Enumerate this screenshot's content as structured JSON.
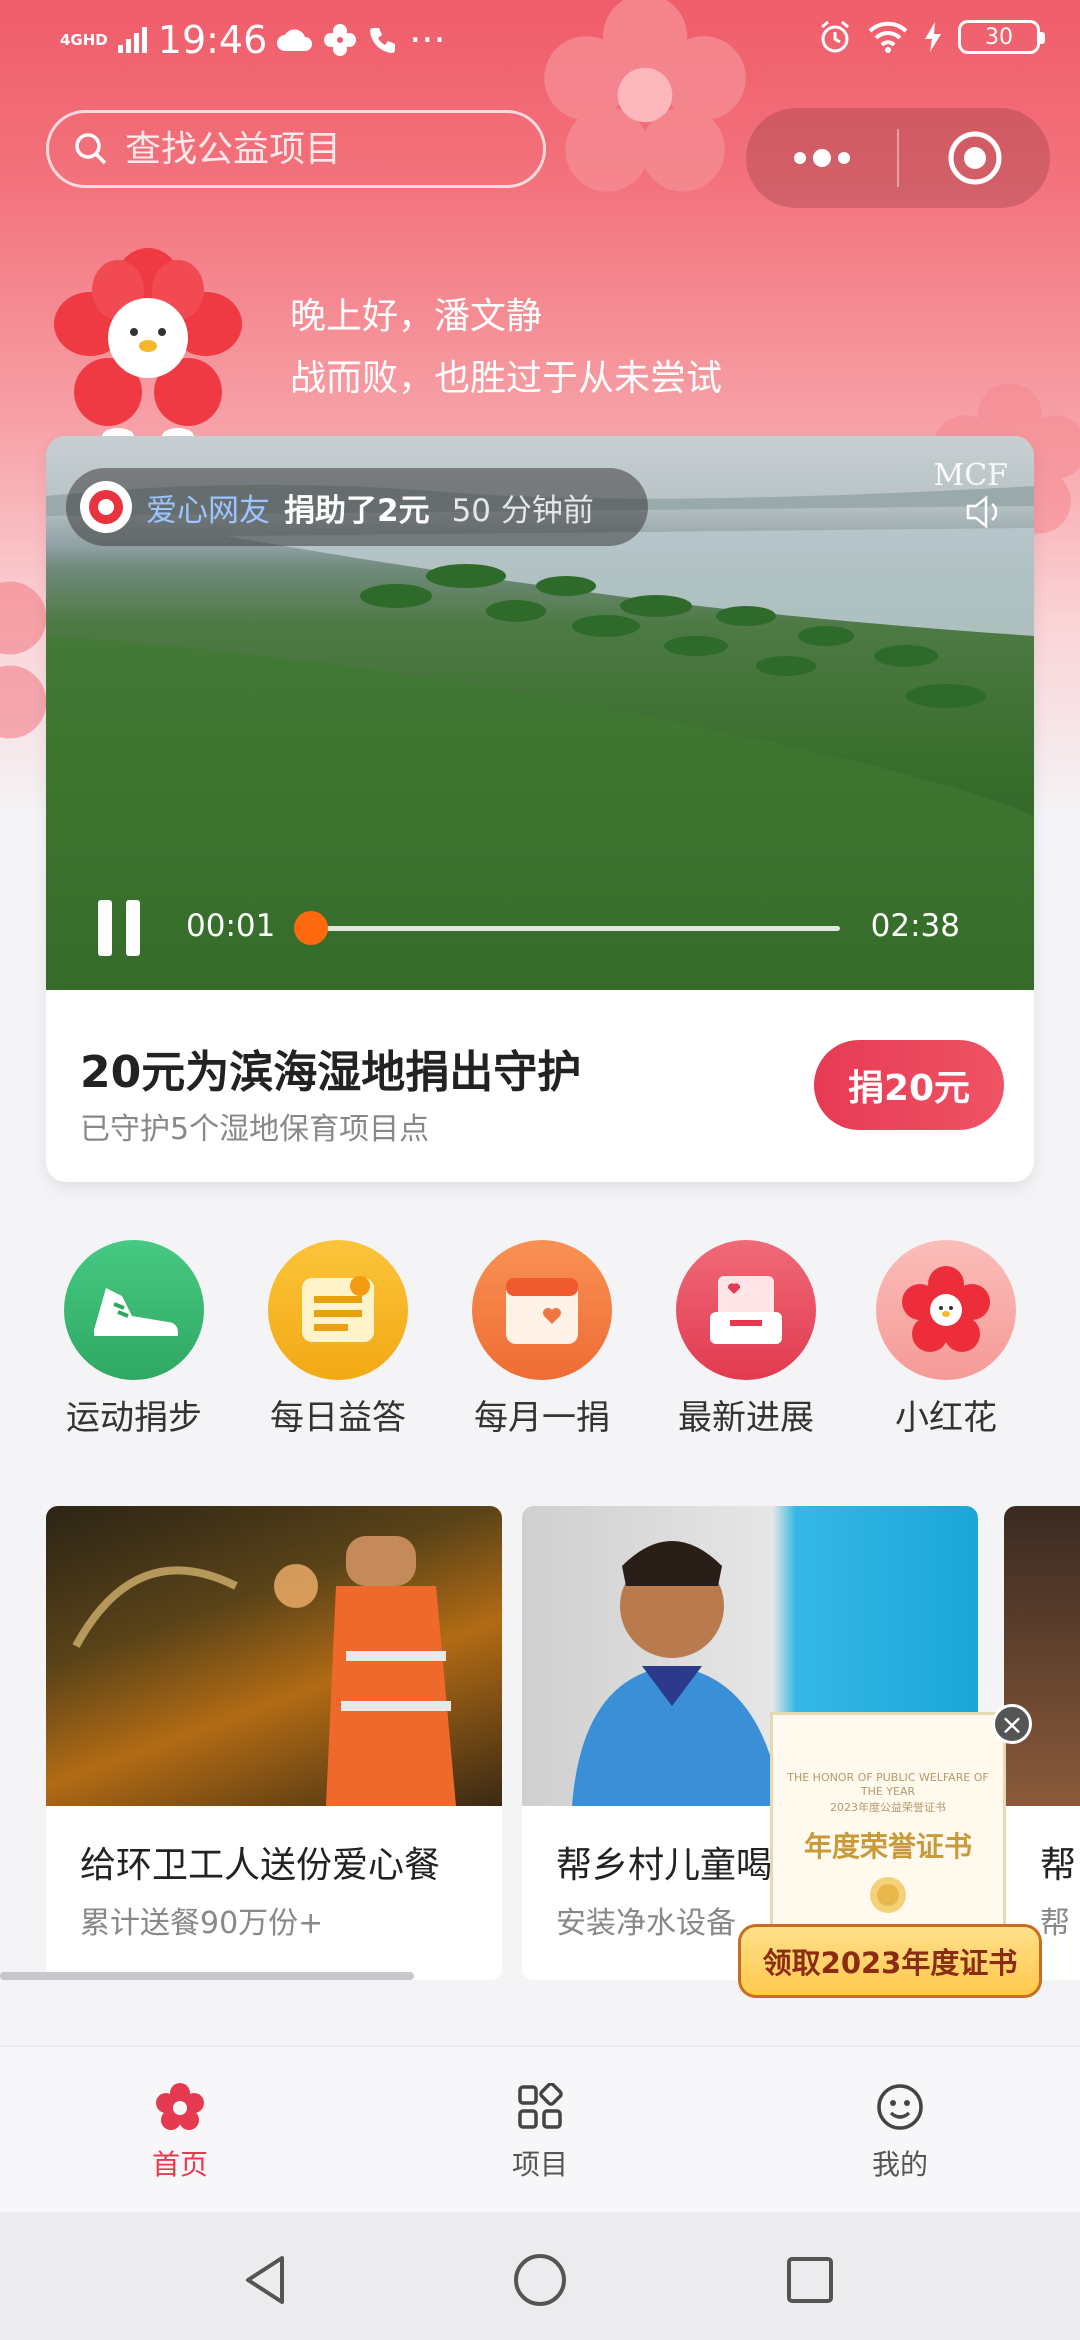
{
  "status_bar": {
    "network": "4GHD",
    "time": "19:46",
    "more": "···",
    "battery": "30"
  },
  "search": {
    "placeholder": "查找公益项目"
  },
  "greeting": {
    "line1": "晚上好，潘文静",
    "line2": "战而败，也胜过于从未尝试"
  },
  "featured": {
    "donor": "爱心网友",
    "donation": "捐助了2元",
    "time_ago": "50 分钟前",
    "brand_logo": "MCF",
    "current_time": "00:01",
    "duration": "02:38",
    "progress": 0.006,
    "title": "20元为滨海湿地捐出守护",
    "subtitle": "已守护5个湿地保育项目点",
    "donate_label": "捐20元"
  },
  "quick_actions": [
    {
      "label": "运动捐步",
      "icon": "sneaker-icon",
      "color": "#3dbb76"
    },
    {
      "label": "每日益答",
      "icon": "quiz-card-icon",
      "color": "#f5b71f"
    },
    {
      "label": "每月一捐",
      "icon": "calendar-heart-icon",
      "color": "#f47a3e"
    },
    {
      "label": "最新进展",
      "icon": "inbox-heart-icon",
      "color": "#ea4a5c"
    },
    {
      "label": "小红花",
      "icon": "red-flower-icon",
      "color": "#f7a9a6"
    }
  ],
  "projects": [
    {
      "title": "给环卫工人送份爱心餐",
      "subtitle": "累计送餐90万份+"
    },
    {
      "title": "帮乡村儿童喝",
      "subtitle": "安装净水设备"
    },
    {
      "title": "帮",
      "subtitle": "帮"
    }
  ],
  "certificate": {
    "english": "THE HONOR OF PUBLIC WELFARE OF THE YEAR",
    "small_zh": "2023年度公益荣誉证书",
    "title": "年度荣誉证书",
    "close": "×",
    "banner": "领取2023年度证书"
  },
  "bottom_nav": [
    {
      "label": "首页",
      "icon": "flower-home-icon",
      "active": true
    },
    {
      "label": "项目",
      "icon": "grid-apps-icon",
      "active": false
    },
    {
      "label": "我的",
      "icon": "smiley-icon",
      "active": false
    }
  ],
  "colors": {
    "primary": "#e53a4f",
    "hero_top": "#ef5d6a",
    "progress": "#ff6a10"
  }
}
